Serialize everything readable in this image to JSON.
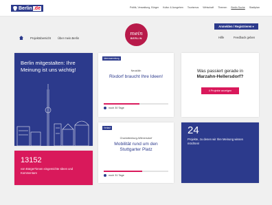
{
  "header": {
    "logo_text": "Berlin",
    "logo_suffix": ".de",
    "links": [
      "Politik, Verwaltung, Bürger",
      "Kultur & Ausgehen",
      "Tourismus",
      "Wirtschaft",
      "Themen",
      "Berlin Suche",
      "Stadtplan"
    ],
    "active_link_index": 5
  },
  "subheader": {
    "breadcrumbs": [
      "Projektübersicht",
      "Über mein.Berlin"
    ],
    "brand_main": "mein",
    "brand_sub": "BERLIN",
    "login_label": "Anmelden / Registrieren",
    "help_label": "Hilfe",
    "feedback_label": "Feedback geben"
  },
  "hero": {
    "title": "Berlin mitgestalten: Ihre Meinung ist uns wichtig!"
  },
  "stat": {
    "number": "13152",
    "text": "von Bürger*innen eingereichte Ideen und Kommentare"
  },
  "projects": [
    {
      "tag": "Ideensammlung",
      "location": "Neukölln",
      "title": "Rixdorf braucht Ihre Ideen!",
      "progress": 0.55,
      "time": "noch 30 Tage"
    },
    {
      "tag": "Verlauf",
      "location": "Charlottenburg-Wilmersdorf",
      "title": "Mobilität rund um den Stuttgarter Platz",
      "progress": 0.6,
      "time": "noch 31 Tage"
    }
  ],
  "whats_new": {
    "title": "Was passiert gerade in",
    "district": "Marzahn-Hellersdorf?",
    "button": "4 Projekte anzeigen"
  },
  "count": {
    "number": "24",
    "text": "Projekte, zu denen wir Ihre Meinung wissen möchten!"
  },
  "colors": {
    "navy": "#2c3a8c",
    "pink": "#d9195b",
    "brand": "#b81a4a"
  }
}
